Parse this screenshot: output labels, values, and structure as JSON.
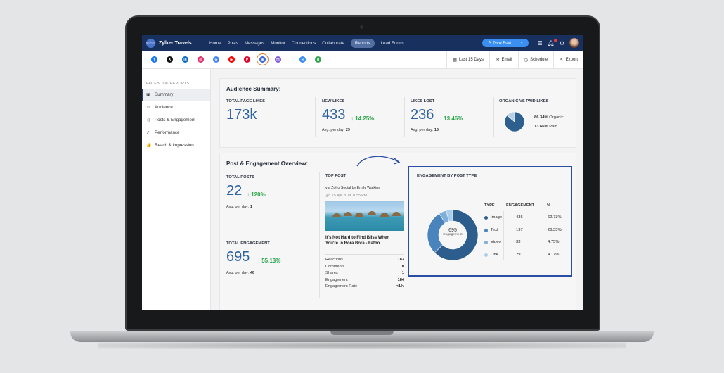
{
  "brand": {
    "name": "Zylker Travels",
    "logo_text": "Zylker Travels"
  },
  "nav": {
    "links": [
      "Home",
      "Posts",
      "Messages",
      "Monitor",
      "Connections",
      "Collaborate",
      "Reports",
      "Lead Forms"
    ],
    "active": "Reports",
    "new_post_label": "New Post"
  },
  "social": {
    "networks": [
      {
        "icon": "facebook-icon",
        "glyph": "f",
        "color": "#1877f2"
      },
      {
        "icon": "x-icon",
        "glyph": "X",
        "color": "#111111"
      },
      {
        "icon": "linkedin-icon",
        "glyph": "in",
        "color": "#0a66c2"
      },
      {
        "icon": "instagram-icon",
        "glyph": "◎",
        "color": "#e1306c"
      },
      {
        "icon": "google-business-icon",
        "glyph": "G",
        "color": "#4285f4"
      },
      {
        "icon": "youtube-icon",
        "glyph": "▶",
        "color": "#ff0000"
      },
      {
        "icon": "pinterest-icon",
        "glyph": "P",
        "color": "#e60023"
      },
      {
        "icon": "microsoft-icon",
        "glyph": "⊞",
        "color": "#3b6bd6"
      },
      {
        "icon": "mastodon-icon",
        "glyph": "m",
        "color": "#7b5bd6"
      },
      {
        "icon": "link-icon",
        "glyph": "∞",
        "color": "#3a8ff0"
      },
      {
        "icon": "tiktok-icon",
        "glyph": "d",
        "color": "#2ea44f"
      }
    ],
    "selected_index": 7
  },
  "toolbar": {
    "date_range": "Last 15 Days",
    "email": "Email",
    "schedule": "Schedule",
    "export": "Export"
  },
  "sidebar": {
    "heading": "FACEBOOK REPORTS",
    "items": [
      {
        "label": "Summary",
        "icon": "summary-icon",
        "glyph": "▣"
      },
      {
        "label": "Audience",
        "icon": "audience-icon",
        "glyph": "☺"
      },
      {
        "label": "Posts & Engagement",
        "icon": "megaphone-icon",
        "glyph": "◁"
      },
      {
        "label": "Performance",
        "icon": "trend-icon",
        "glyph": "↗"
      },
      {
        "label": "Reach & Impression",
        "icon": "thumbs-up-icon",
        "glyph": "👍"
      }
    ],
    "active_index": 0
  },
  "audience": {
    "title": "Audience Summary:",
    "total_page_likes": {
      "label": "TOTAL PAGE LIKES",
      "value": "173k"
    },
    "new_likes": {
      "label": "NEW LIKES",
      "value": "433",
      "change": "↑ 14.25%",
      "avg_label": "Avg. per day:",
      "avg": "29"
    },
    "likes_lost": {
      "label": "LIKES LOST",
      "value": "236",
      "change": "↑ 13.46%",
      "avg_label": "Avg. per day:",
      "avg": "16"
    },
    "organic_paid": {
      "label": "ORGANIC VS PAID LIKES",
      "organic_pct": "86.34%",
      "organic_label": "Organic",
      "paid_pct": "13.66%",
      "paid_label": "Paid",
      "organic_value": 86.34,
      "paid_value": 13.66
    }
  },
  "posts": {
    "title": "Post & Engagement Overview:",
    "total_posts": {
      "label": "TOTAL POSTS",
      "value": "22",
      "change": "↑ 120%",
      "avg_label": "Avg. per day:",
      "avg": "1"
    },
    "total_engagement": {
      "label": "TOTAL ENGAGEMENT",
      "value": "695",
      "change": "↑ 55.13%",
      "avg_label": "Avg. per day:",
      "avg": "46"
    },
    "top_post": {
      "label": "TOP POST",
      "via": "via Zoho Social by Emily Watkins",
      "date": "15 Apr 2019 11:55 PM",
      "caption": "It's Not Hard to Find Bliss When You're in Bora Bora - Fatho...",
      "stats": [
        {
          "name": "Reactions",
          "value": "183"
        },
        {
          "name": "Comments",
          "value": "0"
        },
        {
          "name": "Shares",
          "value": "1"
        },
        {
          "name": "Engagement",
          "value": "184"
        },
        {
          "name": "Engagement Rate",
          "value": "<1%"
        }
      ]
    }
  },
  "engagement_by_type": {
    "title": "ENGAGEMENT BY POST TYPE",
    "center_value": "695",
    "center_label": "Engagement",
    "headers": [
      "TYPE",
      "ENGAGEMENT",
      "%"
    ],
    "rows": [
      {
        "type": "Image",
        "engagement": "436",
        "pct": "62.73%",
        "value": 62.73,
        "color": "#2c5d8c"
      },
      {
        "type": "Text",
        "engagement": "197",
        "pct": "28.35%",
        "value": 28.35,
        "color": "#4a84bd"
      },
      {
        "type": "Video",
        "engagement": "33",
        "pct": "4.75%",
        "value": 4.75,
        "color": "#7fb0dc"
      },
      {
        "type": "Link",
        "engagement": "29",
        "pct": "4.17%",
        "value": 4.17,
        "color": "#a9cdeb"
      }
    ]
  }
}
